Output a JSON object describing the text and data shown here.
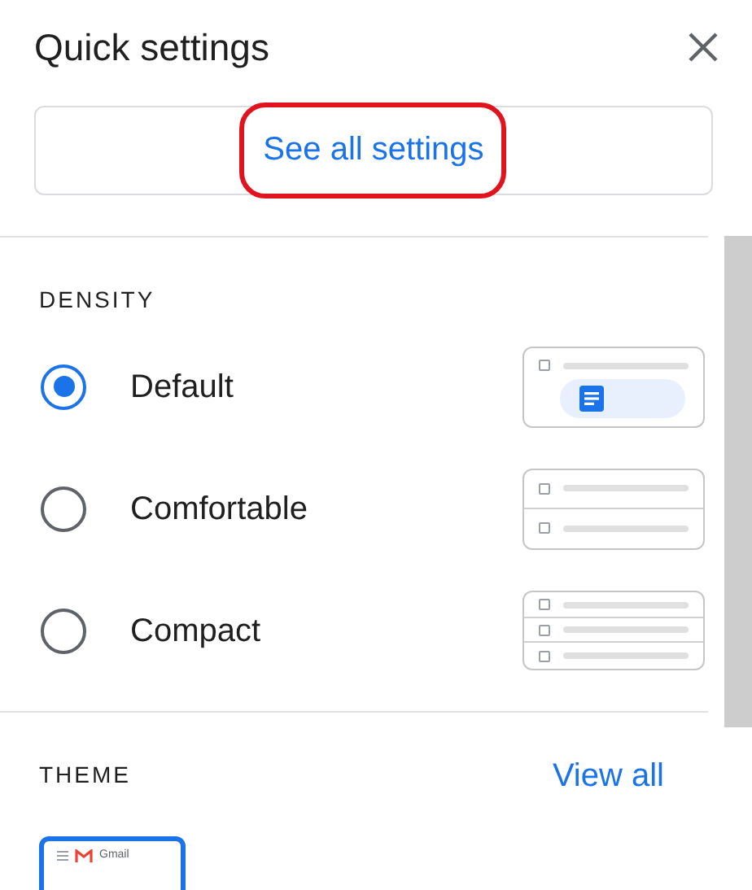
{
  "title": "Quick settings",
  "see_all_button": {
    "label": "See all settings",
    "annotated": true
  },
  "density": {
    "heading": "DENSITY",
    "options": [
      {
        "label": "Default",
        "selected": true,
        "kind": "default"
      },
      {
        "label": "Comfortable",
        "selected": false,
        "kind": "comfortable"
      },
      {
        "label": "Compact",
        "selected": false,
        "kind": "compact"
      }
    ]
  },
  "theme": {
    "heading": "THEME",
    "link": "View all",
    "themes": [
      {
        "label": "Gmail",
        "selected": true
      }
    ]
  }
}
